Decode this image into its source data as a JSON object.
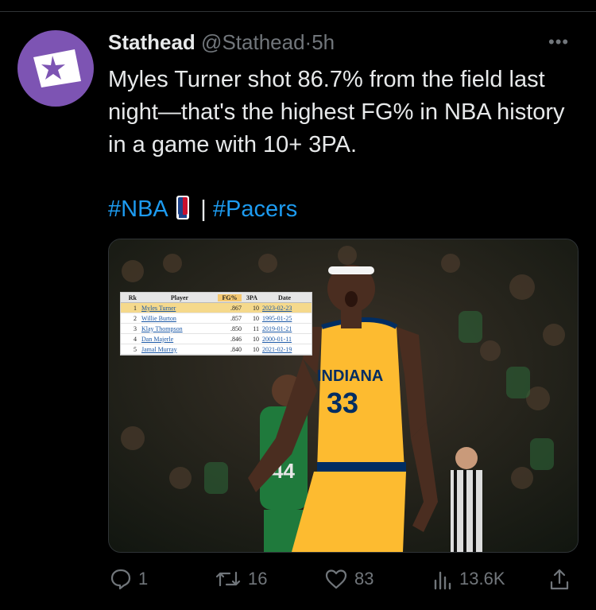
{
  "post": {
    "display_name": "Stathead",
    "handle": "@Stathead",
    "separator": "·",
    "time": "5h",
    "more_label": "•••",
    "text": "Myles Turner shot 86.7% from the field last night—that's the highest FG% in NBA history in a game with 10+ 3PA.",
    "hashtag_nba": "#NBA",
    "tag_separator": "|",
    "hashtag_pacers": "#Pacers"
  },
  "media": {
    "table": {
      "headers": [
        "Rk",
        "Player",
        "FG%",
        "3PA",
        "Date"
      ],
      "rows": [
        {
          "rk": "1",
          "player": "Myles Turner",
          "fg": ".867",
          "tpa": "10",
          "date": "2023-02-23"
        },
        {
          "rk": "2",
          "player": "Willie Burton",
          "fg": ".857",
          "tpa": "10",
          "date": "1995-01-25"
        },
        {
          "rk": "3",
          "player": "Klay Thompson",
          "fg": ".850",
          "tpa": "11",
          "date": "2019-01-21"
        },
        {
          "rk": "4",
          "player": "Dan Majerle",
          "fg": ".846",
          "tpa": "10",
          "date": "2000-01-11"
        },
        {
          "rk": "5",
          "player": "Jamal Murray",
          "fg": ".840",
          "tpa": "10",
          "date": "2021-02-19"
        }
      ]
    },
    "jersey_team": "INDIANA",
    "jersey_number": "33",
    "opponent_number": "44"
  },
  "actions": {
    "replies": "1",
    "reposts": "16",
    "likes": "83",
    "views": "13.6K"
  },
  "colors": {
    "background": "#000000",
    "link": "#1d9bf0",
    "muted": "#71767b",
    "avatar": "#7d54b3",
    "pacers_gold": "#fdbb30",
    "pacers_navy": "#002d62"
  },
  "icons": [
    "reply-icon",
    "repost-icon",
    "like-icon",
    "views-icon",
    "share-icon",
    "more-icon",
    "stathead-logo-icon",
    "nba-logo-icon"
  ]
}
